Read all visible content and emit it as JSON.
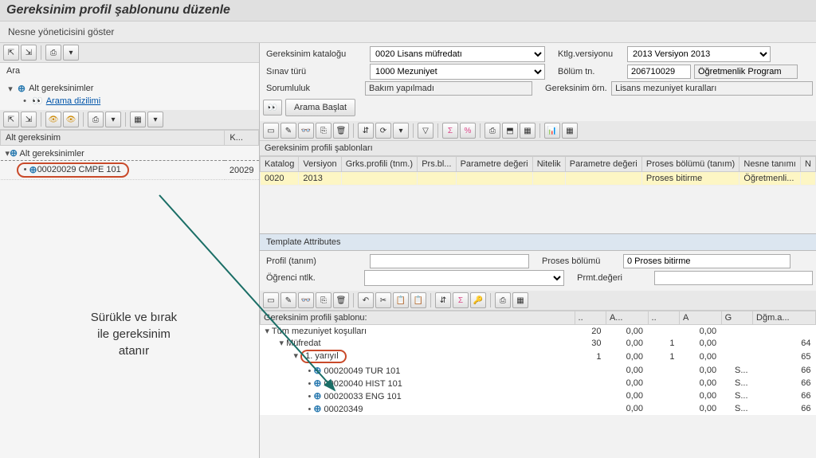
{
  "title": "Gereksinim profil şablonunu düzenle",
  "subtitle": "Nesne yöneticisini göster",
  "leftSearch": "Ara",
  "leftTree": {
    "root": "Alt gereksinimler",
    "child": "Arama dizilimi"
  },
  "leftTable": {
    "col1": "Alt gereksinim",
    "col2": "K...",
    "row1": "Alt gereksinimler",
    "row2_id": "00020029 CMPE 101",
    "row2_code": "20029"
  },
  "callout": {
    "line1": "Sürükle ve bırak",
    "line2": "ile gereksinim",
    "line3": "atanır"
  },
  "form": {
    "katalog_label": "Gereksinim kataloğu",
    "katalog_value": "0020 Lisans müfredatı",
    "version_label": "Ktlg.versiyonu",
    "version_value": "2013 Versiyon 2013",
    "sinav_label": "Sınav türü",
    "sinav_value": "1000 Mezuniyet",
    "bolum_label": "Bölüm tn.",
    "bolum_value": "206710029",
    "program_value": "Öğretmenlik Program",
    "sorumluluk_label": "Sorumluluk",
    "sorumluluk_value": "Bakım yapılmadı",
    "gereksinim_label": "Gereksinim örn.",
    "gereksinim_value": "Lisans mezuniyet kuralları"
  },
  "searchBtn": "Arama Başlat",
  "gridTitle": "Gereksinim profili şablonları",
  "gridCols": {
    "c1": "Katalog",
    "c2": "Versiyon",
    "c3": "Grks.profili (tnm.)",
    "c4": "Prs.bl...",
    "c5": "Parametre değeri",
    "c6": "Nitelik",
    "c7": "Parametre değeri",
    "c8": "Proses bölümü (tanım)",
    "c9": "Nesne tanımı",
    "c10": "N"
  },
  "gridRow": {
    "katalog": "0020",
    "versiyon": "2013",
    "proses": "Proses bitirme",
    "nesne": "Öğretmenli..."
  },
  "attrSection": "Template Attributes",
  "attr": {
    "profil_label": "Profil (tanım)",
    "proses_label": "Proses bölümü",
    "proses_value": "0 Proses bitirme",
    "ogrenci_label": "Öğrenci ntlk.",
    "prmt_label": "Prmt.değeri"
  },
  "profileTreeTitle": "Gereksinim profili şablonu:",
  "profileTreeCols": {
    "c1": "..",
    "c2": "A...",
    "c3": "..",
    "c4": "A",
    "c5": "G",
    "c6": "Dğm.a..."
  },
  "profileTree": [
    {
      "indent": 0,
      "toggle": "▾",
      "label": "Tüm mezuniyet koşulları",
      "v1": "20",
      "v2": "0,00",
      "v3": "",
      "v4": "0,00",
      "v5": "",
      "v6": ""
    },
    {
      "indent": 1,
      "toggle": "▾",
      "label": "Müfredat",
      "v1": "30",
      "v2": "0,00",
      "v3": "1",
      "v4": "0,00",
      "v5": "",
      "v6": "64"
    },
    {
      "indent": 2,
      "toggle": "▾",
      "label": "1. yarıyıl",
      "circled": true,
      "v1": "1",
      "v2": "0,00",
      "v3": "1",
      "v4": "0,00",
      "v5": "",
      "v6": "65"
    },
    {
      "indent": 3,
      "toggle": "•",
      "label": "00020049 TUR 101",
      "plus": true,
      "v1": "",
      "v2": "0,00",
      "v3": "",
      "v4": "0,00",
      "v5": "S...",
      "v6": "66"
    },
    {
      "indent": 3,
      "toggle": "•",
      "label": "00020040 HIST 101",
      "plus": true,
      "v1": "",
      "v2": "0,00",
      "v3": "",
      "v4": "0,00",
      "v5": "S...",
      "v6": "66"
    },
    {
      "indent": 3,
      "toggle": "•",
      "label": "00020033 ENG 101",
      "plus": true,
      "v1": "",
      "v2": "0,00",
      "v3": "",
      "v4": "0,00",
      "v5": "S...",
      "v6": "66"
    },
    {
      "indent": 3,
      "toggle": "•",
      "label": "00020349",
      "plus": true,
      "v1": "",
      "v2": "0,00",
      "v3": "",
      "v4": "0,00",
      "v5": "S...",
      "v6": "66"
    }
  ]
}
